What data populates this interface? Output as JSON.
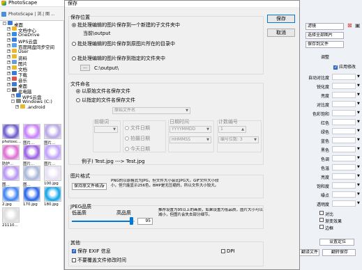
{
  "app": {
    "title": "PhotoScape",
    "toolbar_text": "PhotoScape  |  浏.| 图 ...",
    "tree": [
      {
        "label": "桌面",
        "expand": "-"
      },
      {
        "label": "文档中心",
        "expand": "+"
      },
      {
        "label": "OneDrive",
        "expand": "+"
      },
      {
        "label": "WPS云盘",
        "expand": "+"
      },
      {
        "label": "百度网盘同步空间",
        "expand": "+"
      },
      {
        "label": "User",
        "expand": "+"
      },
      {
        "label": "资料",
        "expand": "+"
      },
      {
        "label": "图片",
        "expand": "+"
      },
      {
        "label": "文档",
        "expand": "+"
      },
      {
        "label": "下载",
        "expand": "+"
      },
      {
        "label": "音乐",
        "expand": "+"
      },
      {
        "label": "桌面",
        "expand": "+"
      },
      {
        "label": "此电脑",
        "expand": "-"
      },
      {
        "label": "WPS云盘",
        "expand": "+"
      },
      {
        "label": "Windows (C:)",
        "expand": "-"
      },
      {
        "label": ".android",
        "expand": "+"
      }
    ],
    "thumbnails": [
      {
        "label": "photosc..."
      },
      {
        "label": "图片..."
      },
      {
        "label": "图片..."
      },
      {
        "label": "防护..."
      },
      {
        "label": "图片..."
      },
      {
        "label": "图片..."
      },
      {
        "label": "图..."
      },
      {
        "label": "图..."
      },
      {
        "label": "100.jpg"
      },
      {
        "label": "2.jpg"
      },
      {
        "label": "170.jpg"
      },
      {
        "label": "180.jpg"
      },
      {
        "label": "21110..."
      }
    ]
  },
  "right_panel": {
    "top_buttons": [
      "滤镜",
      "选择全部图片",
      "保存到文件"
    ],
    "section_label": "调整",
    "auto_adjust": "应用修改",
    "rows": [
      "自动对比度",
      "锐化度",
      "亮度",
      "对比度",
      "色彩饱和",
      "红色",
      "绿色",
      "蓝色",
      "黑色",
      "色调",
      "色温",
      "亮度",
      "饱和度",
      "噪点",
      "透明度"
    ],
    "checks": [
      "对比",
      "渐变效果",
      "边框"
    ],
    "bottom_buttons": [
      "翻译文件",
      "保存",
      "翻转保存"
    ],
    "bottom_button_extra": "设置定位"
  },
  "dialog": {
    "title": "保存",
    "save_button": "保存",
    "cancel_button": "取消",
    "save_location": {
      "title": "保存位置",
      "option1": "批处理编辑的图片保存到一个新建的子文件夹中",
      "option1_path": "当前\\output",
      "option2": "批处理编辑的图片保存到原图片所在的目录中",
      "option3": "批处理编辑的图片保存到指定的文件夹中",
      "folder_button": "...",
      "folder_path": "C:\\output\\"
    },
    "file_naming": {
      "title": "文件命名",
      "option1": "以原始文件名保存文件",
      "option2": "以指定的文件名保存文件",
      "name_combo": "原始文件名",
      "prefix_label": "前缀词",
      "date_label": "日期时间",
      "counter_label": "计数编号",
      "radio_file_date": "文件日期",
      "radio_shoot_date": "拍摄日期",
      "radio_today": "今天日期",
      "date_format": "YYYYMMDD",
      "time_format": "HHMMSS",
      "counter_value": "1",
      "counter_digits": "编号位数: 3",
      "example": "例子) Test.jpg ---> Test.jpg"
    },
    "image_format": {
      "title": "图片格式",
      "combo": "保持原文件格式",
      "description": "PNG的以原格式为JPG，但文件大小会比JPG大。GIF文件大小较小，但只能显示256色，BMP是无压缩的，所以文件大小较大。"
    },
    "jpeg_quality": {
      "title": "JPEG品质",
      "low_label": "低画质",
      "high_label": "高品质",
      "value": "95",
      "quality_level": 0.94,
      "description": "推荐设置为95以上的画质，如果设置为低品质，图片大小可以减小，但图片会失去部分细节。"
    },
    "other": {
      "title": "其他",
      "keep_exif": "保存 EXIF 信息",
      "keep_exif_checked": true,
      "no_overwrite": "不要覆盖文件修改时间",
      "no_overwrite_checked": false,
      "dpi": "DPI",
      "dpi_checked": false
    }
  }
}
